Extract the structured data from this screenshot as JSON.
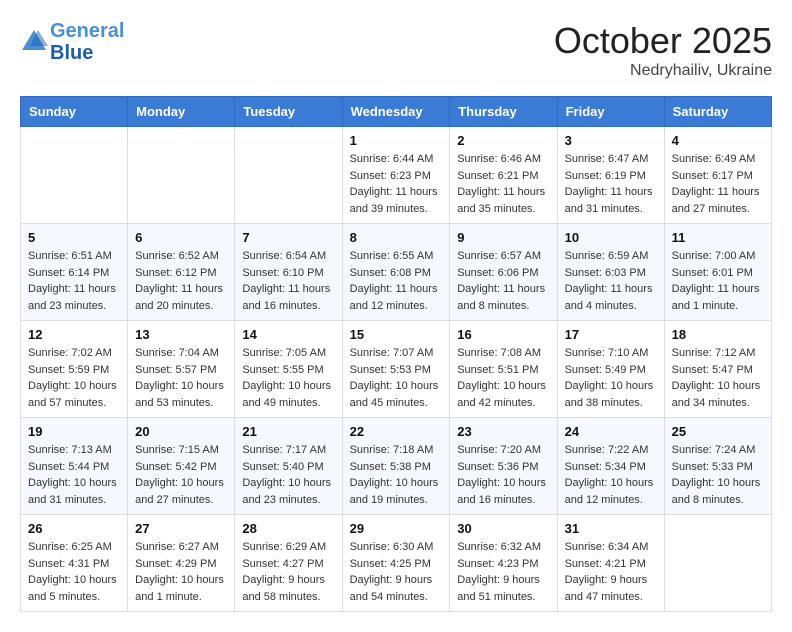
{
  "header": {
    "logo_line1": "General",
    "logo_line2": "Blue",
    "month": "October 2025",
    "location": "Nedryhailiv, Ukraine"
  },
  "weekdays": [
    "Sunday",
    "Monday",
    "Tuesday",
    "Wednesday",
    "Thursday",
    "Friday",
    "Saturday"
  ],
  "weeks": [
    [
      {
        "day": "",
        "info": ""
      },
      {
        "day": "",
        "info": ""
      },
      {
        "day": "",
        "info": ""
      },
      {
        "day": "1",
        "info": "Sunrise: 6:44 AM\nSunset: 6:23 PM\nDaylight: 11 hours\nand 39 minutes."
      },
      {
        "day": "2",
        "info": "Sunrise: 6:46 AM\nSunset: 6:21 PM\nDaylight: 11 hours\nand 35 minutes."
      },
      {
        "day": "3",
        "info": "Sunrise: 6:47 AM\nSunset: 6:19 PM\nDaylight: 11 hours\nand 31 minutes."
      },
      {
        "day": "4",
        "info": "Sunrise: 6:49 AM\nSunset: 6:17 PM\nDaylight: 11 hours\nand 27 minutes."
      }
    ],
    [
      {
        "day": "5",
        "info": "Sunrise: 6:51 AM\nSunset: 6:14 PM\nDaylight: 11 hours\nand 23 minutes."
      },
      {
        "day": "6",
        "info": "Sunrise: 6:52 AM\nSunset: 6:12 PM\nDaylight: 11 hours\nand 20 minutes."
      },
      {
        "day": "7",
        "info": "Sunrise: 6:54 AM\nSunset: 6:10 PM\nDaylight: 11 hours\nand 16 minutes."
      },
      {
        "day": "8",
        "info": "Sunrise: 6:55 AM\nSunset: 6:08 PM\nDaylight: 11 hours\nand 12 minutes."
      },
      {
        "day": "9",
        "info": "Sunrise: 6:57 AM\nSunset: 6:06 PM\nDaylight: 11 hours\nand 8 minutes."
      },
      {
        "day": "10",
        "info": "Sunrise: 6:59 AM\nSunset: 6:03 PM\nDaylight: 11 hours\nand 4 minutes."
      },
      {
        "day": "11",
        "info": "Sunrise: 7:00 AM\nSunset: 6:01 PM\nDaylight: 11 hours\nand 1 minute."
      }
    ],
    [
      {
        "day": "12",
        "info": "Sunrise: 7:02 AM\nSunset: 5:59 PM\nDaylight: 10 hours\nand 57 minutes."
      },
      {
        "day": "13",
        "info": "Sunrise: 7:04 AM\nSunset: 5:57 PM\nDaylight: 10 hours\nand 53 minutes."
      },
      {
        "day": "14",
        "info": "Sunrise: 7:05 AM\nSunset: 5:55 PM\nDaylight: 10 hours\nand 49 minutes."
      },
      {
        "day": "15",
        "info": "Sunrise: 7:07 AM\nSunset: 5:53 PM\nDaylight: 10 hours\nand 45 minutes."
      },
      {
        "day": "16",
        "info": "Sunrise: 7:08 AM\nSunset: 5:51 PM\nDaylight: 10 hours\nand 42 minutes."
      },
      {
        "day": "17",
        "info": "Sunrise: 7:10 AM\nSunset: 5:49 PM\nDaylight: 10 hours\nand 38 minutes."
      },
      {
        "day": "18",
        "info": "Sunrise: 7:12 AM\nSunset: 5:47 PM\nDaylight: 10 hours\nand 34 minutes."
      }
    ],
    [
      {
        "day": "19",
        "info": "Sunrise: 7:13 AM\nSunset: 5:44 PM\nDaylight: 10 hours\nand 31 minutes."
      },
      {
        "day": "20",
        "info": "Sunrise: 7:15 AM\nSunset: 5:42 PM\nDaylight: 10 hours\nand 27 minutes."
      },
      {
        "day": "21",
        "info": "Sunrise: 7:17 AM\nSunset: 5:40 PM\nDaylight: 10 hours\nand 23 minutes."
      },
      {
        "day": "22",
        "info": "Sunrise: 7:18 AM\nSunset: 5:38 PM\nDaylight: 10 hours\nand 19 minutes."
      },
      {
        "day": "23",
        "info": "Sunrise: 7:20 AM\nSunset: 5:36 PM\nDaylight: 10 hours\nand 16 minutes."
      },
      {
        "day": "24",
        "info": "Sunrise: 7:22 AM\nSunset: 5:34 PM\nDaylight: 10 hours\nand 12 minutes."
      },
      {
        "day": "25",
        "info": "Sunrise: 7:24 AM\nSunset: 5:33 PM\nDaylight: 10 hours\nand 8 minutes."
      }
    ],
    [
      {
        "day": "26",
        "info": "Sunrise: 6:25 AM\nSunset: 4:31 PM\nDaylight: 10 hours\nand 5 minutes."
      },
      {
        "day": "27",
        "info": "Sunrise: 6:27 AM\nSunset: 4:29 PM\nDaylight: 10 hours\nand 1 minute."
      },
      {
        "day": "28",
        "info": "Sunrise: 6:29 AM\nSunset: 4:27 PM\nDaylight: 9 hours\nand 58 minutes."
      },
      {
        "day": "29",
        "info": "Sunrise: 6:30 AM\nSunset: 4:25 PM\nDaylight: 9 hours\nand 54 minutes."
      },
      {
        "day": "30",
        "info": "Sunrise: 6:32 AM\nSunset: 4:23 PM\nDaylight: 9 hours\nand 51 minutes."
      },
      {
        "day": "31",
        "info": "Sunrise: 6:34 AM\nSunset: 4:21 PM\nDaylight: 9 hours\nand 47 minutes."
      },
      {
        "day": "",
        "info": ""
      }
    ]
  ]
}
